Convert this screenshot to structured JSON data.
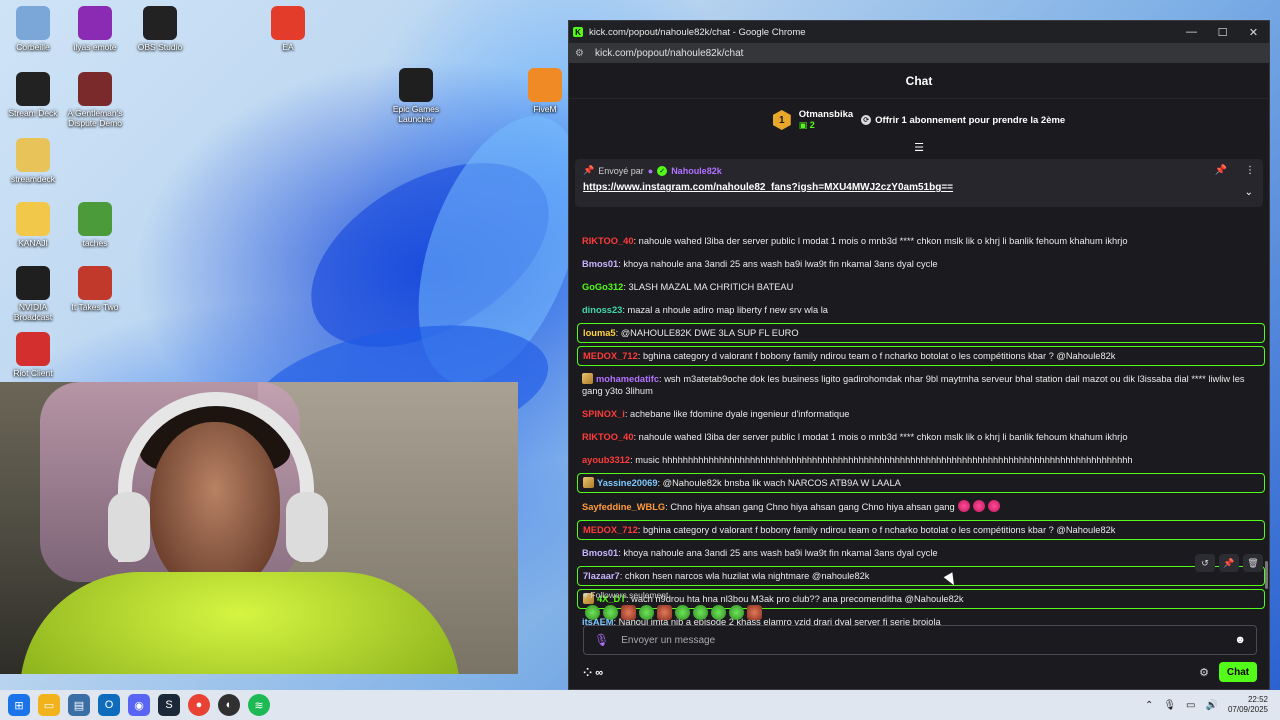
{
  "desktop": {
    "icons": [
      {
        "label": "Corbeille"
      },
      {
        "label": "ilyas emote"
      },
      {
        "label": "OBS Studio"
      },
      {
        "label": "EA"
      },
      {
        "label": "Stream Deck"
      },
      {
        "label": "A Gentleman's Dispute Demo"
      },
      {
        "label": "Epic Games Launcher"
      },
      {
        "label": "FiveM"
      },
      {
        "label": "streamdeck"
      },
      {
        "label": "KANAJI"
      },
      {
        "label": "taches"
      },
      {
        "label": "NVIDIA Broadcast"
      },
      {
        "label": "It Takes Two"
      },
      {
        "label": "Riot Client"
      }
    ]
  },
  "window": {
    "title": "kick.com/popout/nahoule82k/chat - Google Chrome",
    "url": "kick.com/popout/nahoule82k/chat",
    "controls": {
      "minimize": "—",
      "maximize": "☐",
      "close": "✕"
    }
  },
  "chat": {
    "header": "Chat",
    "gift": {
      "rank": "1",
      "user": "Otmansbika",
      "count": "2",
      "text": "Offrir 1 abonnement pour prendre la 2ème"
    },
    "pinned": {
      "sent_by": "Envoyé par",
      "user": "Nahoule82k",
      "link": "https://www.instagram.com/nahoule82_fans?igsh=MXU4MWJ2czY0am51bg=="
    },
    "messages": [
      {
        "user": "RIKTOO_40",
        "color": "#ff3b3b",
        "text": ": nahoule wahed l3iba der server public l modat 1 mois o mnb3d **** chkon mslk lik o khrj li banlik fehoum khahum ikhrjo",
        "highlight": false,
        "badge": false
      },
      {
        "user": "Bmos01",
        "color": "#c9b3ff",
        "text": ": khoya nahoule ana 3andi 25 ans wash ba9i lwa9t fin nkamal 3ans dyal cycle",
        "highlight": false,
        "badge": false
      },
      {
        "user": "GoGo312",
        "color": "#53fc18",
        "text": ": 3LASH MAZAL MA CHRITICH BATEAU",
        "highlight": false,
        "badge": false
      },
      {
        "user": "dinoss23",
        "color": "#3fd9a8",
        "text": ": mazal a nhoule adiro map liberty f new srv wla la",
        "highlight": false,
        "badge": false
      },
      {
        "user": "louma5",
        "color": "#ffd23f",
        "text": ": @NAHOULE82K DWE 3LA SUP FL EURO",
        "highlight": true,
        "badge": false
      },
      {
        "user": "MEDOX_712",
        "color": "#ff3b3b",
        "text": ": bghina category d valorant f bobony family ndirou team o f ncharko botolat o les compétitions kbar ? @Nahoule82k",
        "highlight": true,
        "badge": false
      },
      {
        "user": "mohamedatifc",
        "color": "#b470ff",
        "text": ": wsh m3atetab9oche dok les business ligito gadirohomdak nhar 9bl maytmha serveur bhal station dail mazot ou dik l3issaba dial **** liwliw les gang y3to 3lihum",
        "highlight": false,
        "badge": true
      },
      {
        "user": "SPINOX_i",
        "color": "#ff3b3b",
        "text": ": achebane like fdomine dyale ingenieur d'informatique",
        "highlight": false,
        "badge": false
      },
      {
        "user": "RIKTOO_40",
        "color": "#ff3b3b",
        "text": ": nahoule wahed l3iba der server public l modat 1 mois o mnb3d **** chkon mslk lik o khrj li banlik fehoum khahum ikhrjo",
        "highlight": false,
        "badge": false
      },
      {
        "user": "ayoub3312",
        "color": "#ff3b3b",
        "text": ": music hhhhhhhhhhhhhhhhhhhhhhhhhhhhhhhhhhhhhhhhhhhhhhhhhhhhhhhhhhhhhhhhhhhhhhhhhhhhhhhhhhhhhhhhhhh",
        "highlight": false,
        "badge": false
      },
      {
        "user": "Yassine20069",
        "color": "#7ec8ff",
        "text": ": @Nahoule82k bnsba lik wach NARCOS ATB9A W LAALA",
        "highlight": true,
        "badge": true
      },
      {
        "user": "Sayfeddine_WBLG",
        "color": "#ff9a3b",
        "text": ": Chno hiya ahsan gang Chno hiya ahsan gang Chno hiya ahsan gang",
        "highlight": false,
        "badge": false,
        "emotes": 3
      },
      {
        "user": "MEDOX_712",
        "color": "#ff3b3b",
        "text": ": bghina category d valorant f bobony family ndirou team o f ncharko botolat o les compétitions kbar ? @Nahoule82k",
        "highlight": true,
        "badge": false
      },
      {
        "user": "Bmos01",
        "color": "#c9b3ff",
        "text": ": khoya nahoule ana 3andi 25 ans wash ba9i lwa9t fin nkamal 3ans dyal cycle",
        "highlight": false,
        "badge": false
      },
      {
        "user": "7lazaar7",
        "color": "#c9b3ff",
        "text": ": chkon hsen narcos wla huzilat wla nightmare @nahoule82k",
        "highlight": true,
        "badge": false
      },
      {
        "user": "4X_DT",
        "color": "#53fc18",
        "text": ": wach n9drou hta hna nl3bou M3ak pro club?? ana precomenditha @Nahoule82k",
        "highlight": true,
        "badge": true
      },
      {
        "user": "itsAEM",
        "color": "#7ec8ff",
        "text": ": Nahoul imta nib a episode 2 khass elamro yzid drari dyal server fi serie brojola",
        "highlight": false,
        "badge": false
      }
    ],
    "followers_only": "Followers seulement",
    "input_placeholder": "Envoyer un message",
    "send_label": "Chat"
  },
  "taskbar": {
    "time": "22:52",
    "date": "07/09/2025"
  }
}
